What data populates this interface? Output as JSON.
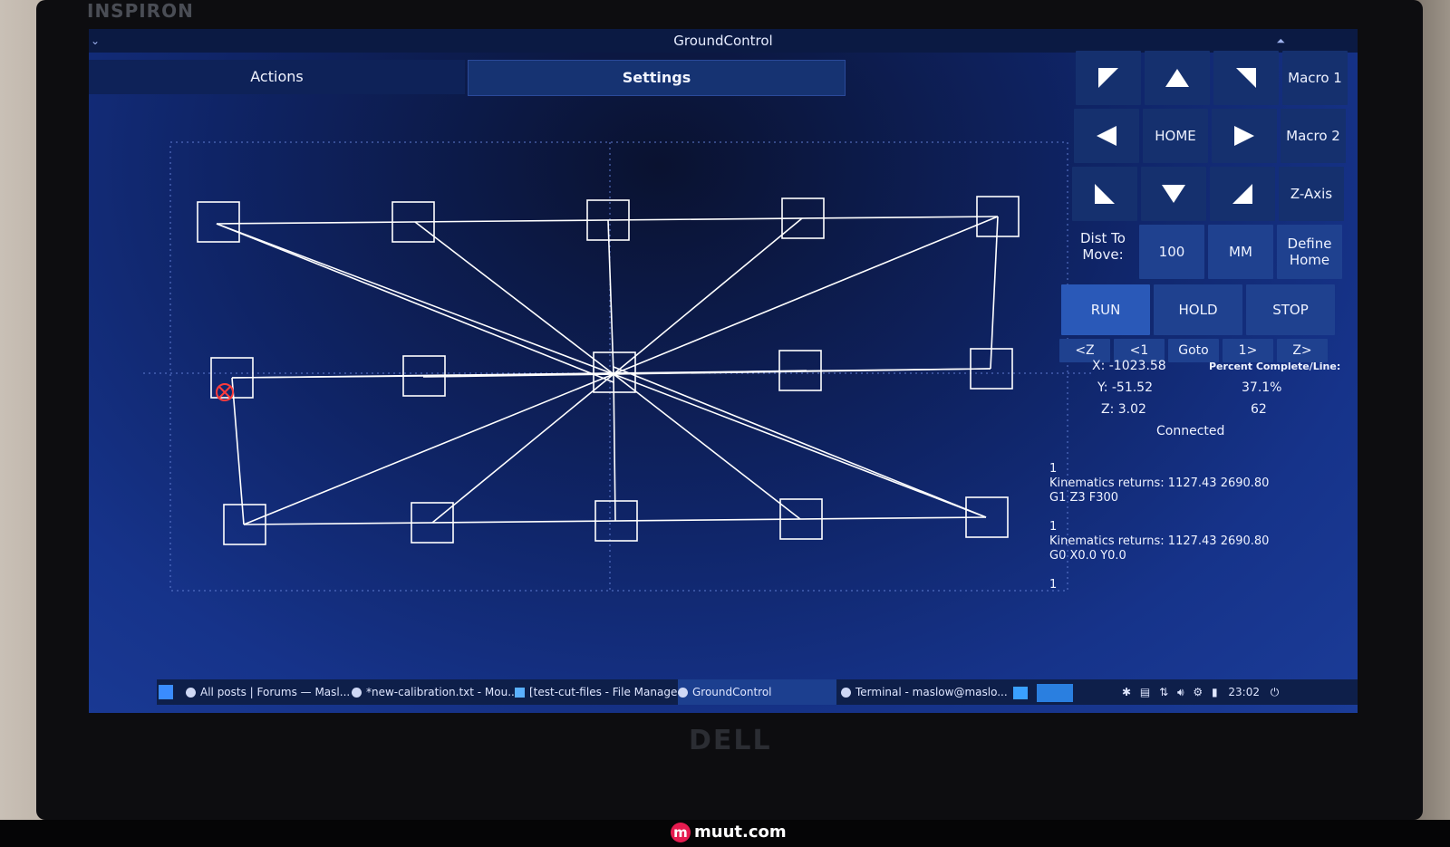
{
  "device": {
    "brand": "INSPIRON",
    "logo": "DELL"
  },
  "window": {
    "title": "GroundControl"
  },
  "tabs": [
    "Actions",
    "Settings"
  ],
  "controls": {
    "macro1": "Macro 1",
    "macro2": "Macro 2",
    "home": "HOME",
    "zaxis": "Z-Axis",
    "dist_label": "Dist To Move:",
    "dist_value": "100",
    "units": "MM",
    "define_home": "Define Home",
    "run": "RUN",
    "hold": "HOLD",
    "stop": "STOP",
    "nav": [
      "<Z",
      "<1",
      "Goto",
      "1>",
      "Z>"
    ]
  },
  "readout": {
    "x": "X: -1023.58",
    "y": "Y: -51.52",
    "z": "Z: 3.02",
    "percent_label": "Percent Complete/Line:",
    "percent": "37.1%",
    "line": "62",
    "status": "Connected"
  },
  "console": [
    "1",
    "Kinematics returns: 1127.43 2690.80",
    "G1 Z3 F300",
    "",
    "1",
    "Kinematics returns: 1127.43 2690.80",
    "G0 X0.0 Y0.0",
    "",
    "1"
  ],
  "taskbar": {
    "items": [
      "All posts | Forums — Masl...",
      "*new-calibration.txt - Mou...",
      "[test-cut-files - File Manager]",
      "GroundControl",
      "Terminal - maslow@maslo..."
    ],
    "clock": "23:02"
  },
  "watermark": "muut.com",
  "colors": {
    "accent": "#1f418f",
    "background": "#16338a",
    "lines": "#ffffff",
    "marker": "#ff3b3b"
  }
}
